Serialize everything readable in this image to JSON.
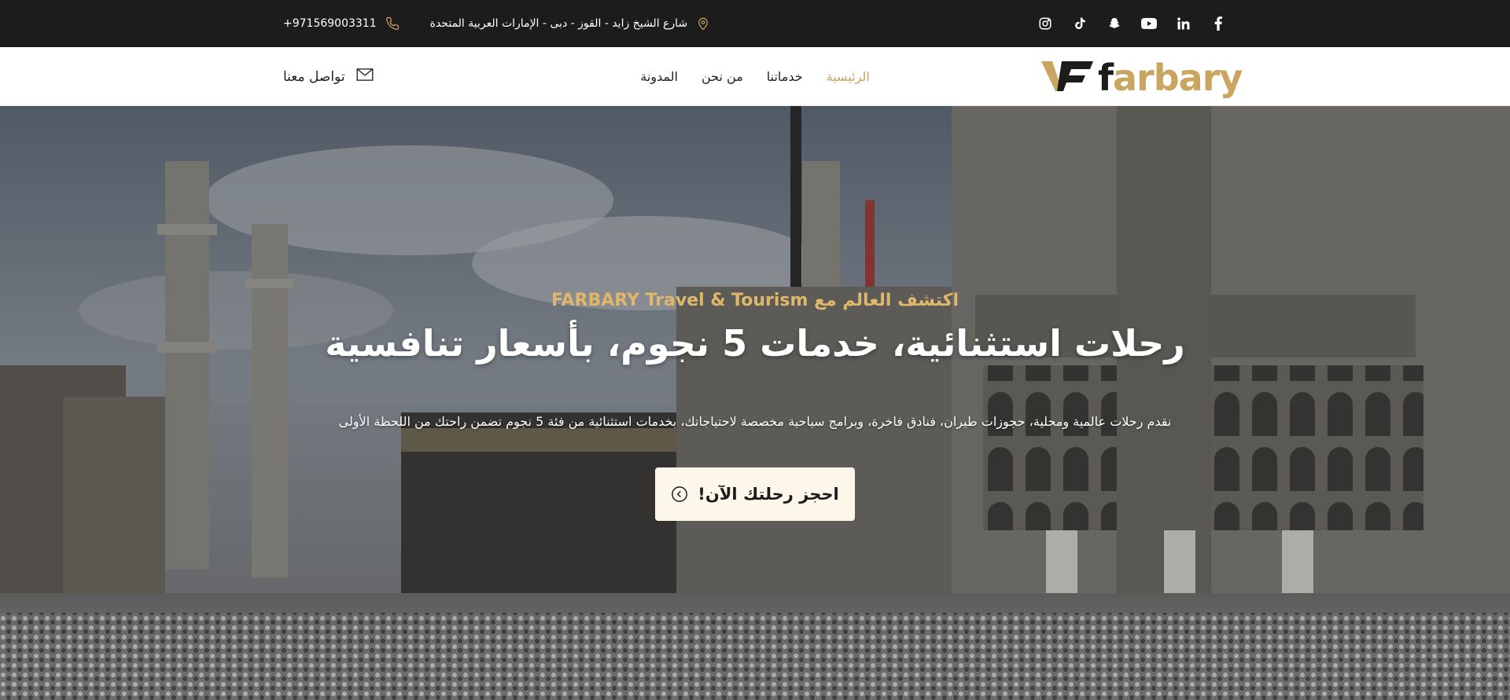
{
  "topbar": {
    "phone": "+971569003311",
    "address": "شارع الشيخ زايد - القوز - دبى - الإمارات العربية المتحدة",
    "phone_icon": "phone-icon",
    "location_icon": "location-pin-icon",
    "socials": [
      {
        "name": "instagram-icon"
      },
      {
        "name": "tiktok-icon"
      },
      {
        "name": "snapchat-icon"
      },
      {
        "name": "youtube-icon"
      },
      {
        "name": "linkedin-icon"
      },
      {
        "name": "facebook-icon"
      }
    ]
  },
  "nav": {
    "contact_label": "تواصل معنا",
    "links": [
      {
        "label": "الرئيسية",
        "active": true
      },
      {
        "label": "خدماتنا",
        "active": false
      },
      {
        "label": "من نحن",
        "active": false
      },
      {
        "label": "المدونة",
        "active": false
      }
    ],
    "logo_text": "farbary"
  },
  "hero": {
    "eyebrow": "اكتشف العالم مع FARBARY Travel & Tourism",
    "headline": "رحلات استثنائية، خدمات 5 نجوم، بأسعار تنافسية",
    "subline": "نقدم رحلات عالمية ومحلية، حجوزات طيران، فنادق فاخرة، وبرامج سياحية مخصصة لاحتياجاتك، بخدمات استثنائية من فئة 5 نجوم تضمن راحتك من اللحظة الأولى",
    "cta_label": "احجز رحلتك الآن!"
  },
  "colors": {
    "accent": "#c9a55f",
    "topbar_bg": "#1c1c1c",
    "cta_bg": "#fdf6ea"
  }
}
